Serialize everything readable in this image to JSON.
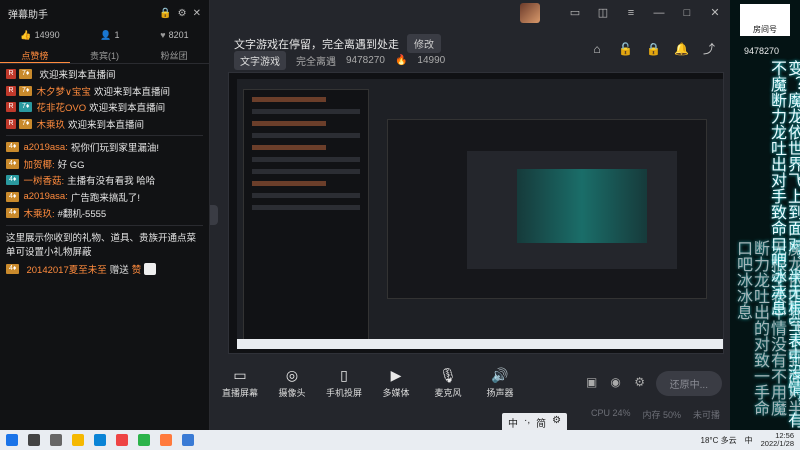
{
  "danmu_window": {
    "title": "弹幕助手",
    "stats": {
      "likes": "14990",
      "users": "1",
      "hearts": "8201"
    },
    "tabs": [
      "点赞榜",
      "贵宾(1)",
      "粉丝团"
    ],
    "messages": [
      {
        "badge": "",
        "name": "",
        "text": "欢迎来到本直播间"
      },
      {
        "badge": "",
        "name": "木夕梦∨宝宝",
        "text": "欢迎来到本直播间"
      },
      {
        "badge": "",
        "name": "花非花OVO",
        "text": "欢迎来到本直播间"
      },
      {
        "badge": "",
        "name": "木乘玖",
        "text": "欢迎来到本直播间"
      },
      {
        "badge": "",
        "name": "a2019asa:",
        "text": "祝你们玩到家里漏油!"
      },
      {
        "badge": "",
        "name": "加贺椰:",
        "text": "好 GG"
      },
      {
        "badge": "",
        "name": "一树香菇:",
        "text": "主播有没有看我 哈哈"
      },
      {
        "badge": "",
        "name": "a2019asa:",
        "text": "广告跑来搞乱了!"
      },
      {
        "badge": "",
        "name": "木乘玖:",
        "text": "#翻机-5555"
      }
    ],
    "notice": "这里展示你收到的礼物、道具、贵族开通点菜单可设置小礼物屏蔽",
    "gift": {
      "user": "20142017夏至未至",
      "action": "赠送",
      "item": "赞"
    }
  },
  "main_window": {
    "room_title": "文字游戏在停留，完全离遇到处走",
    "modify_label": "修改",
    "category": "文字游戏",
    "meta_prefix": "完全离遇",
    "room_id": "9478270",
    "popularity": "14990",
    "bottom_tools": [
      "直播屏幕",
      "摄像头",
      "手机投屏",
      "多媒体",
      "麦克风",
      "扬声器"
    ],
    "live_button": "还原中...",
    "status": {
      "cpu": "CPU 24%",
      "mem": "内存 50%",
      "net": "未可播"
    }
  },
  "ime": {
    "items": [
      "中",
      "·,",
      "简",
      "⚙"
    ]
  },
  "overlay": {
    "logo_text": "房间号",
    "room_number": "9478270",
    "column1": "变？魔龙依世界飞上到面对，半无根空表中没情，有不魔断力龙吐出对手致命口吧冰冰息",
    "column2": "魔龙依田界飞上到面对半无根空表中情没有不用魔断力龙吐出的对致一手命口吧冰冰息"
  },
  "taskbar": {
    "weather": "18°C 多云",
    "time": "12:56",
    "date": "2022/1/28",
    "ime_label": "中"
  }
}
